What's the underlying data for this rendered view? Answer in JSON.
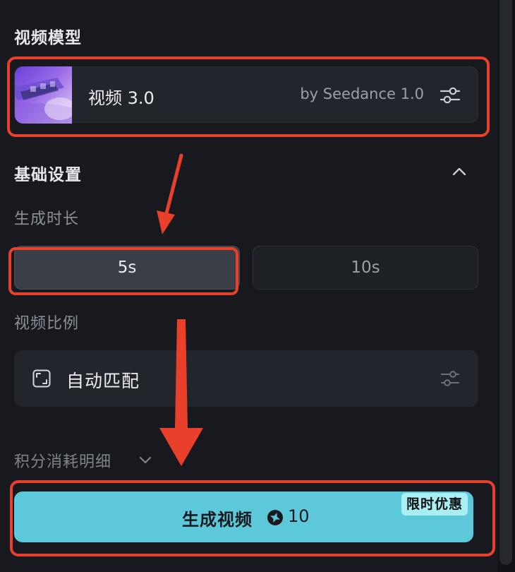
{
  "video_model": {
    "section_title": "视频模型",
    "model_name": "视频 3.0",
    "model_provider": "by Seedance 1.0",
    "settings_icon": "sliders-icon",
    "thumbnail_icon": "model-thumbnail"
  },
  "basic_settings": {
    "section_title": "基础设置",
    "collapse_icon": "chevron-up-icon",
    "duration": {
      "label": "生成时长",
      "options": [
        "5s",
        "10s"
      ],
      "selected": "5s"
    },
    "aspect_ratio": {
      "label": "视频比例",
      "value": "自动匹配",
      "icon": "aspect-ratio-icon",
      "settings_icon": "sliders-icon"
    }
  },
  "credits": {
    "label": "积分消耗明细",
    "expand_icon": "chevron-down-icon"
  },
  "generate_button": {
    "label": "生成视频",
    "cost": "10",
    "cost_icon": "credit-icon",
    "badge": "限时优惠"
  },
  "colors": {
    "accent": "#5ec8db",
    "badge": "#a9eef2",
    "annotation": "#e8402a",
    "panel": "#17191e",
    "card": "#22252b"
  }
}
